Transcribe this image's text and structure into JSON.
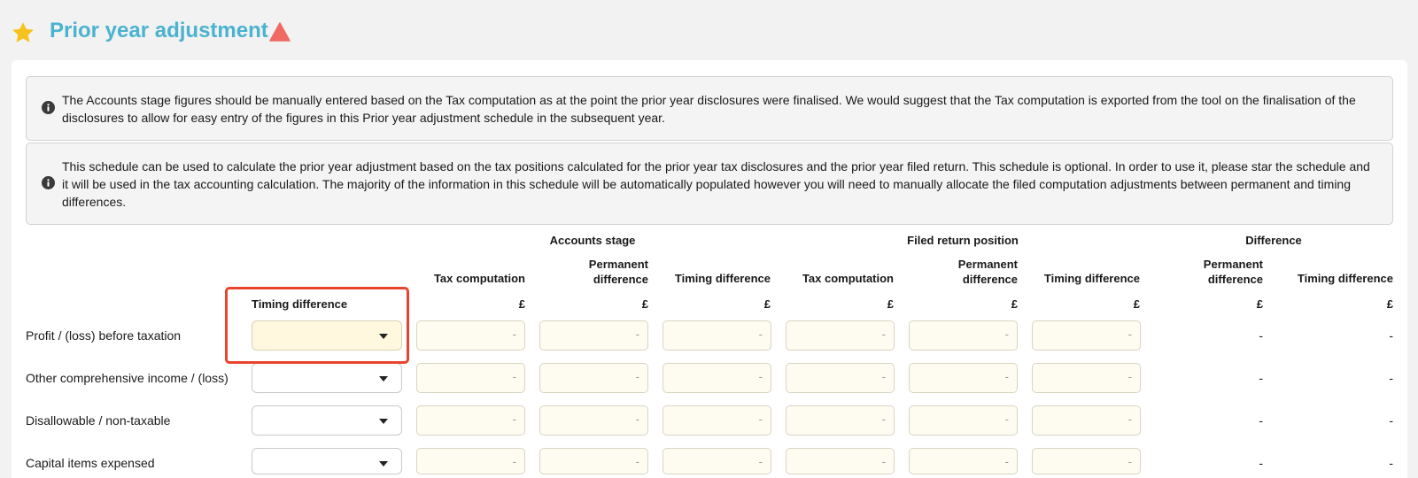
{
  "header": {
    "title": "Prior year adjustment",
    "star_color": "#f7c21d",
    "warning_color": "#f06a64",
    "title_color": "#4ab3cf"
  },
  "info_messages": [
    "The Accounts stage figures should be manually entered based on the Tax computation as at the point the prior year disclosures were finalised. We would suggest that the Tax computation is exported from the tool on the finalisation of the disclosures to allow for easy entry of the figures in this Prior year adjustment schedule in the subsequent year.",
    "This schedule can be used to calculate the prior year adjustment based on the tax positions calculated for the prior year tax disclosures and the prior year filed return. This schedule is optional. In order to use it, please star the schedule and it will be used in the tax accounting calculation. The majority of the information in this schedule will be automatically populated however you will need to manually allocate the filed computation adjustments between permanent and timing differences."
  ],
  "table": {
    "groups": {
      "accounts_stage": "Accounts stage",
      "filed_return": "Filed return position",
      "difference": "Difference"
    },
    "columns": {
      "timing_type": "Timing difference",
      "tax_computation": "Tax computation",
      "permanent_difference_1": "Permanent",
      "permanent_difference_2": "difference",
      "timing_difference": "Timing difference"
    },
    "currency": "£",
    "input_placeholder": "-",
    "rows": [
      {
        "label": "Profit / (loss) before taxation",
        "diff_permanent": "-",
        "diff_timing": "-"
      },
      {
        "label": "Other comprehensive income / (loss)",
        "diff_permanent": "-",
        "diff_timing": "-"
      },
      {
        "label": "Disallowable / non-taxable",
        "diff_permanent": "-",
        "diff_timing": "-"
      },
      {
        "label": "Capital items expensed",
        "diff_permanent": "-",
        "diff_timing": "-"
      }
    ]
  },
  "highlight_color": "#e8452c"
}
